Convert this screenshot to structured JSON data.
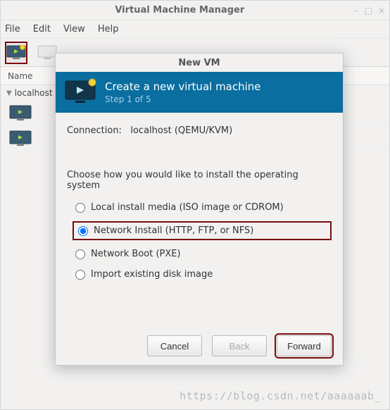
{
  "window": {
    "title": "Virtual Machine Manager",
    "minimize": "–",
    "maximize": "□",
    "close": "×"
  },
  "menu": {
    "file": "File",
    "edit": "Edit",
    "view": "View",
    "help": "Help"
  },
  "list": {
    "header_name": "Name"
  },
  "tree": {
    "host": "localhost"
  },
  "dialog": {
    "title": "New VM",
    "header_line1": "Create a new virtual machine",
    "header_line2": "Step 1 of 5",
    "connection_label": "Connection:",
    "connection_value": "localhost (QEMU/KVM)",
    "choose_label": "Choose how you would like to install the operating system",
    "options": {
      "local": "Local install media (ISO image or CDROM)",
      "network_install": "Network Install (HTTP, FTP, or NFS)",
      "network_boot": "Network Boot (PXE)",
      "import": "Import existing disk image"
    },
    "buttons": {
      "cancel": "Cancel",
      "back": "Back",
      "forward": "Forward"
    }
  },
  "watermark": "https://blog.csdn.net/aaaaaab_"
}
